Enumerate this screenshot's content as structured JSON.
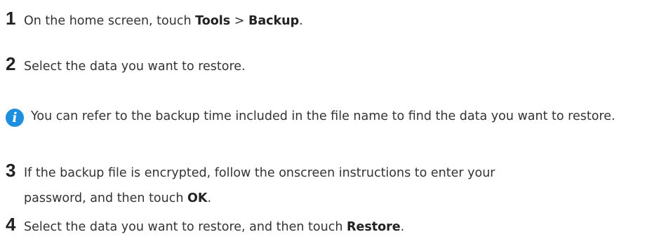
{
  "steps": [
    {
      "number": "1",
      "parts": [
        "On the home screen, touch ",
        "Tools",
        " > ",
        "Backup",
        "."
      ]
    },
    {
      "number": "2",
      "text": "Select the data you want to restore."
    },
    {
      "number": "3",
      "parts": [
        "If the backup file is encrypted, follow the onscreen instructions to enter your",
        "password, and then touch ",
        "OK",
        "."
      ]
    },
    {
      "number": "4",
      "parts": [
        "Select the data you want to restore, and then touch ",
        "Restore",
        "."
      ]
    }
  ],
  "note": {
    "icon": "info-icon",
    "text": "You can refer to the backup time included in the file name to find the data you want to restore."
  }
}
